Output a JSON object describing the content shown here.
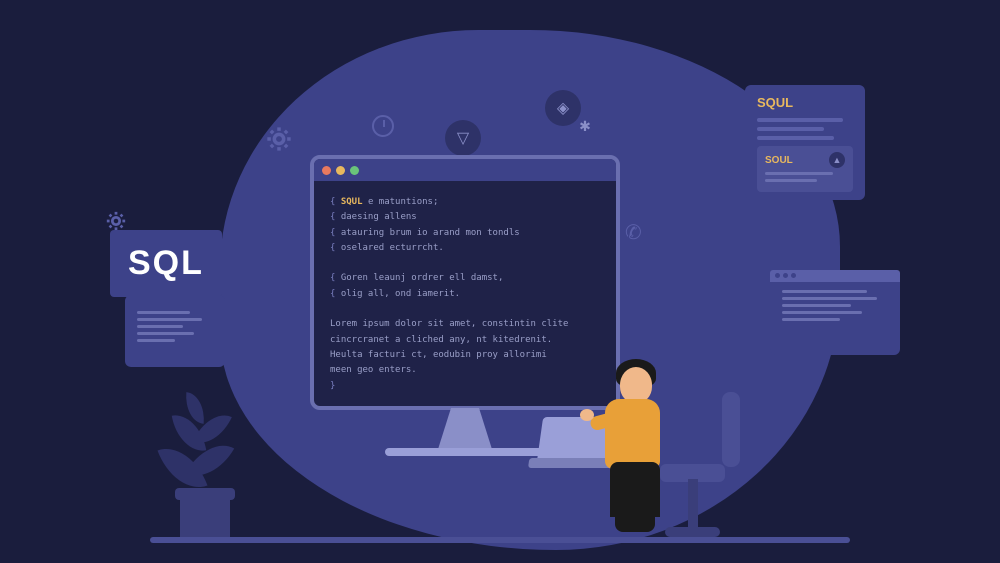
{
  "sql_badge": "SQL",
  "monitor": {
    "code_lines": [
      {
        "brace": "{",
        "kw": "SQUL",
        "rest": " e matuntions;"
      },
      {
        "brace": "{",
        "rest": "daesing allens"
      },
      {
        "brace": "{",
        "rest": "atauring brum io arand mon tondls"
      },
      {
        "brace": "{",
        "rest": "oselared ecturrcht."
      },
      {
        "brace": "",
        "rest": ""
      },
      {
        "brace": "{",
        "rest": "Goren leaunj ordrer ell damst,"
      },
      {
        "brace": "{",
        "rest": "olig all, ond iamerit."
      },
      {
        "brace": "",
        "rest": ""
      },
      {
        "brace": "",
        "rest": "Lorem ipsum dolor sit amet, constintin clite"
      },
      {
        "brace": "",
        "rest": "cincrcranet a cliched any, nt kitedrenit."
      },
      {
        "brace": "",
        "rest": "Heulta facturi ct, eodubin proy allorimi"
      },
      {
        "brace": "",
        "rest": "meen geo enters."
      },
      {
        "brace": "}",
        "rest": ""
      }
    ]
  },
  "card_sql": {
    "title": "SQUL",
    "subtitle": "SOUL"
  },
  "icons": {
    "play": "▽",
    "code": "◈",
    "star": "✱",
    "nav": "▲"
  }
}
